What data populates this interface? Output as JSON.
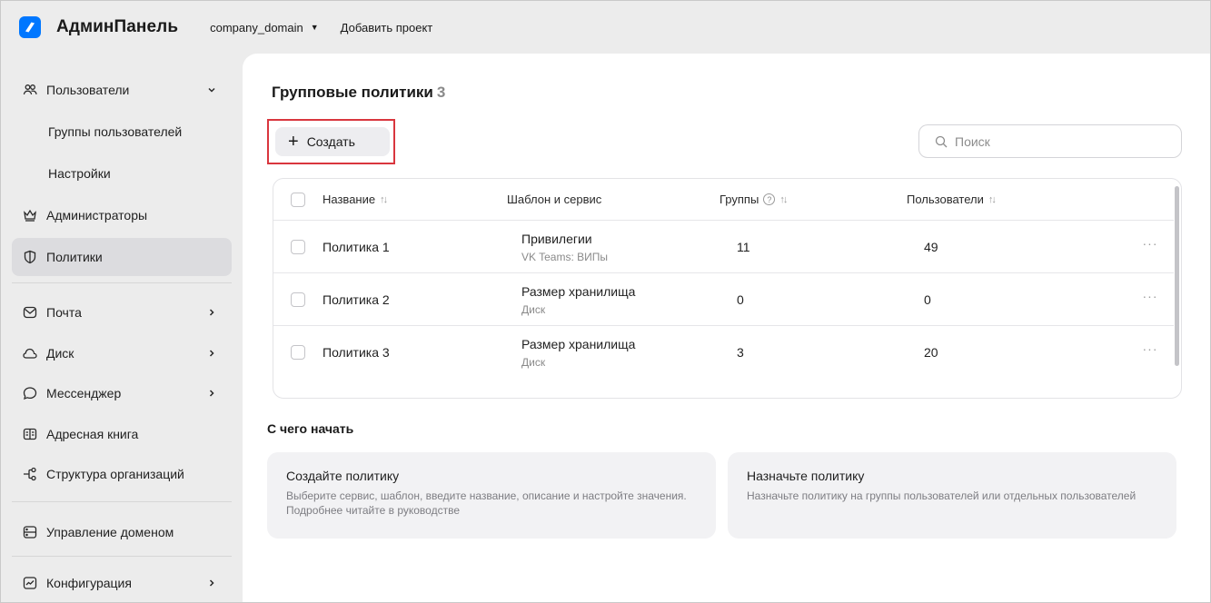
{
  "app": {
    "title": "АдминПанель",
    "domain": "company_domain",
    "add_project": "Добавить проект"
  },
  "sidebar": {
    "items": [
      {
        "label": "Пользователи",
        "icon": "users-icon"
      },
      {
        "label": "Группы пользователей"
      },
      {
        "label": "Настройки"
      },
      {
        "label": "Администраторы",
        "icon": "crown-icon"
      },
      {
        "label": "Политики",
        "icon": "shield-icon"
      },
      {
        "label": "Почта",
        "icon": "mail-icon"
      },
      {
        "label": "Диск",
        "icon": "cloud-icon"
      },
      {
        "label": "Мессенджер",
        "icon": "chat-bubble-icon"
      },
      {
        "label": "Адресная книга",
        "icon": "address-book-icon"
      },
      {
        "label": "Структура организаций",
        "icon": "org-structure-icon"
      },
      {
        "label": "Управление доменом",
        "icon": "domain-icon"
      },
      {
        "label": "Конфигурация",
        "icon": "chart-icon"
      }
    ]
  },
  "main": {
    "title": "Групповые политики",
    "count": "3",
    "create_label": "Создать",
    "search_placeholder": "Поиск",
    "table": {
      "columns": [
        "Название",
        "Шаблон и сервис",
        "Группы",
        "Пользователи"
      ],
      "rows": [
        {
          "name": "Политика 1",
          "template": "Привилегии",
          "service": "VK Teams: ВИПы",
          "groups": "11",
          "users": "49"
        },
        {
          "name": "Политика 2",
          "template": "Размер хранилища",
          "service": "Диск",
          "groups": "0",
          "users": "0"
        },
        {
          "name": "Политика 3",
          "template": "Размер хранилища",
          "service": "Диск",
          "groups": "3",
          "users": "20"
        }
      ],
      "row_menu": "···"
    },
    "getting_started": {
      "title": "С чего начать",
      "cards": [
        {
          "title": "Создайте политику",
          "desc": "Выберите сервис, шаблон, введите название, описание и настройте значения. Подробнее читайте в руководстве"
        },
        {
          "title": "Назначьте политику",
          "desc": "Назначьте политику на группы пользователей или отдельных пользователей"
        }
      ]
    }
  },
  "colors": {
    "accent": "#0077ff",
    "highlight": "#d9363e",
    "sidebar_bg": "#ececec",
    "active_item": "#dcdcdf"
  }
}
